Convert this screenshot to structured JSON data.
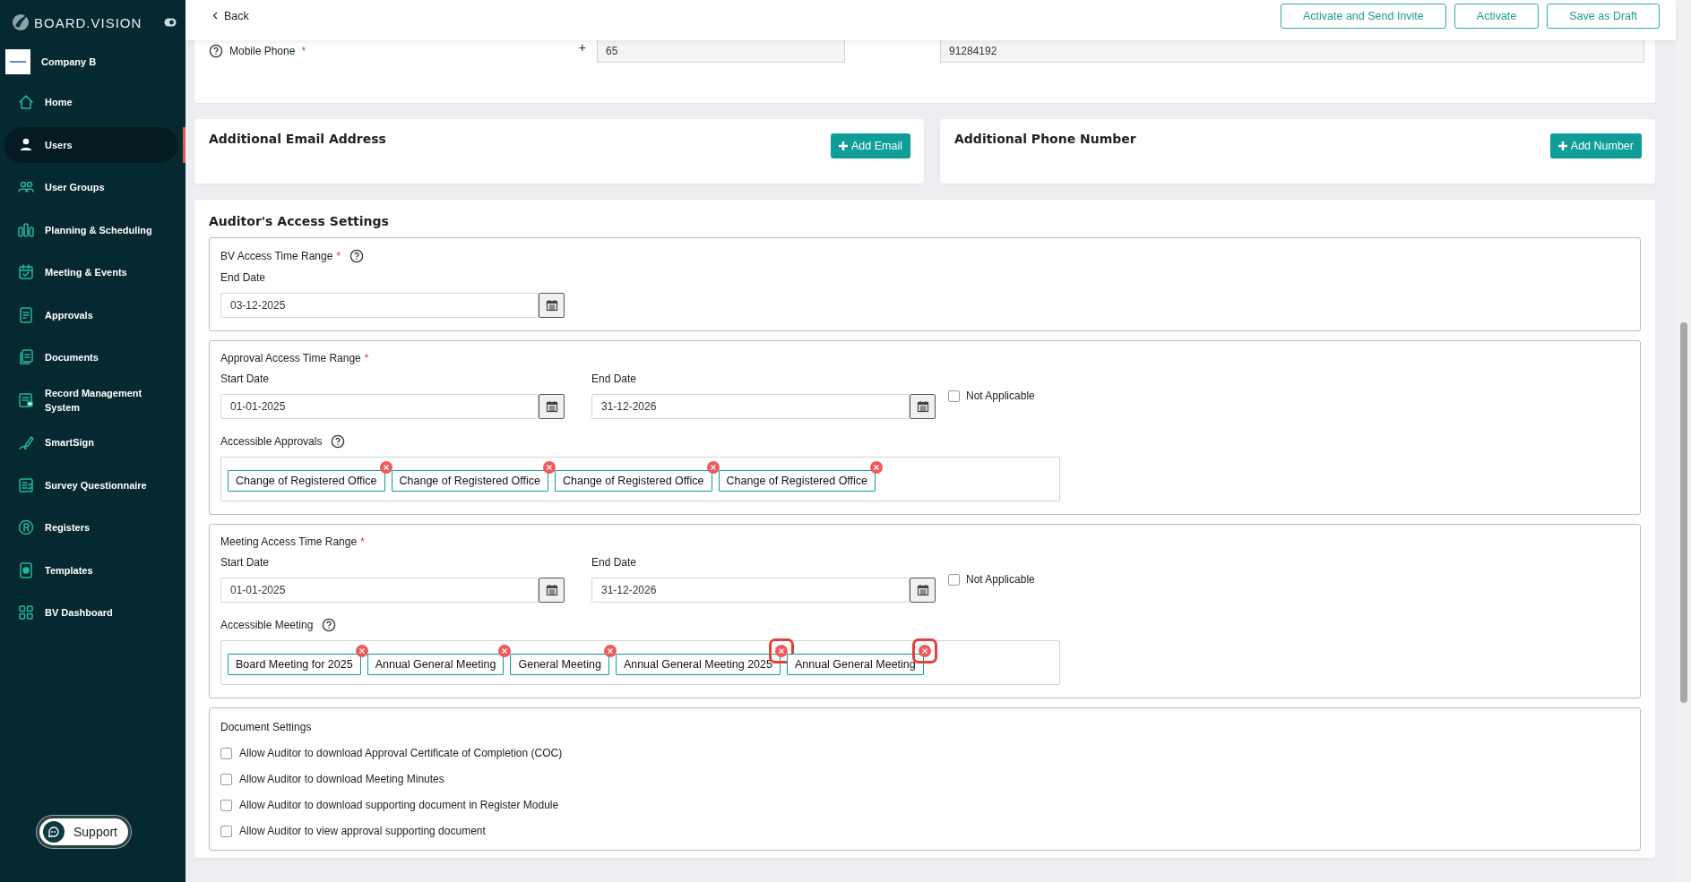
{
  "sidebar": {
    "logo": "BOARD.VISION",
    "company": "Company B",
    "items": [
      {
        "label": "Home",
        "selected": false
      },
      {
        "label": "Users",
        "selected": true
      },
      {
        "label": "User Groups",
        "selected": false
      },
      {
        "label": "Planning & Scheduling",
        "selected": false
      },
      {
        "label": "Meeting & Events",
        "selected": false
      },
      {
        "label": "Approvals",
        "selected": false
      },
      {
        "label": "Documents",
        "selected": false
      },
      {
        "label": "Record Management System",
        "selected": false
      },
      {
        "label": "SmartSign",
        "selected": false
      },
      {
        "label": "Survey Questionnaire",
        "selected": false
      },
      {
        "label": "Registers",
        "selected": false
      },
      {
        "label": "Templates",
        "selected": false
      },
      {
        "label": "BV Dashboard",
        "selected": false
      }
    ],
    "support": "Support"
  },
  "header": {
    "back": "Back",
    "buttons": [
      "Activate and Send Invite",
      "Activate",
      "Save as Draft"
    ]
  },
  "contact": {
    "label": "Mobile Phone",
    "required_mark": "*",
    "prefix": "+",
    "country_code": "65",
    "number": "91284192"
  },
  "additional_email": {
    "title": "Additional Email Address",
    "button": "Add Email"
  },
  "additional_phone": {
    "title": "Additional Phone Number",
    "button": "Add Number"
  },
  "auditor": {
    "title": "Auditor's Access Settings",
    "bv": {
      "label": "BV Access Time Range",
      "required_mark": "*",
      "end_label": "End Date",
      "end_value": "03-12-2025"
    },
    "approval": {
      "label": "Approval Access Time Range",
      "required_mark": "*",
      "start_label": "Start Date",
      "start_value": "01-01-2025",
      "end_label": "End Date",
      "end_value": "31-12-2026",
      "not_applicable": {
        "label": "Not Applicable",
        "checked": false
      },
      "list_label": "Accessible Approvals",
      "tags": [
        {
          "label": "Change of Registered Office",
          "highlighted": false
        },
        {
          "label": "Change of Registered Office",
          "highlighted": false
        },
        {
          "label": "Change of Registered Office",
          "highlighted": false
        },
        {
          "label": "Change of Registered Office",
          "highlighted": false
        }
      ]
    },
    "meeting": {
      "label": "Meeting Access Time Range",
      "required_mark": "*",
      "start_label": "Start Date",
      "start_value": "01-01-2025",
      "end_label": "End Date",
      "end_value": "31-12-2026",
      "not_applicable": {
        "label": "Not Applicable",
        "checked": false
      },
      "list_label": "Accessible Meeting",
      "tags": [
        {
          "label": "Board Meeting for 2025",
          "highlighted": false
        },
        {
          "label": "Annual General Meeting",
          "highlighted": false
        },
        {
          "label": "General Meeting",
          "highlighted": false
        },
        {
          "label": "Annual General Meeting 2025",
          "highlighted": true
        },
        {
          "label": "Annual General Meeting",
          "highlighted": true
        }
      ]
    },
    "documents": {
      "title": "Document Settings",
      "options": [
        {
          "label": "Allow Auditor to download Approval Certificate of Completion (COC)",
          "checked": false
        },
        {
          "label": "Allow Auditor to download Meeting Minutes",
          "checked": false
        },
        {
          "label": "Allow Auditor to download supporting document in Register Module",
          "checked": false
        },
        {
          "label": "Allow Auditor to view approval supporting document",
          "checked": false
        }
      ]
    }
  }
}
